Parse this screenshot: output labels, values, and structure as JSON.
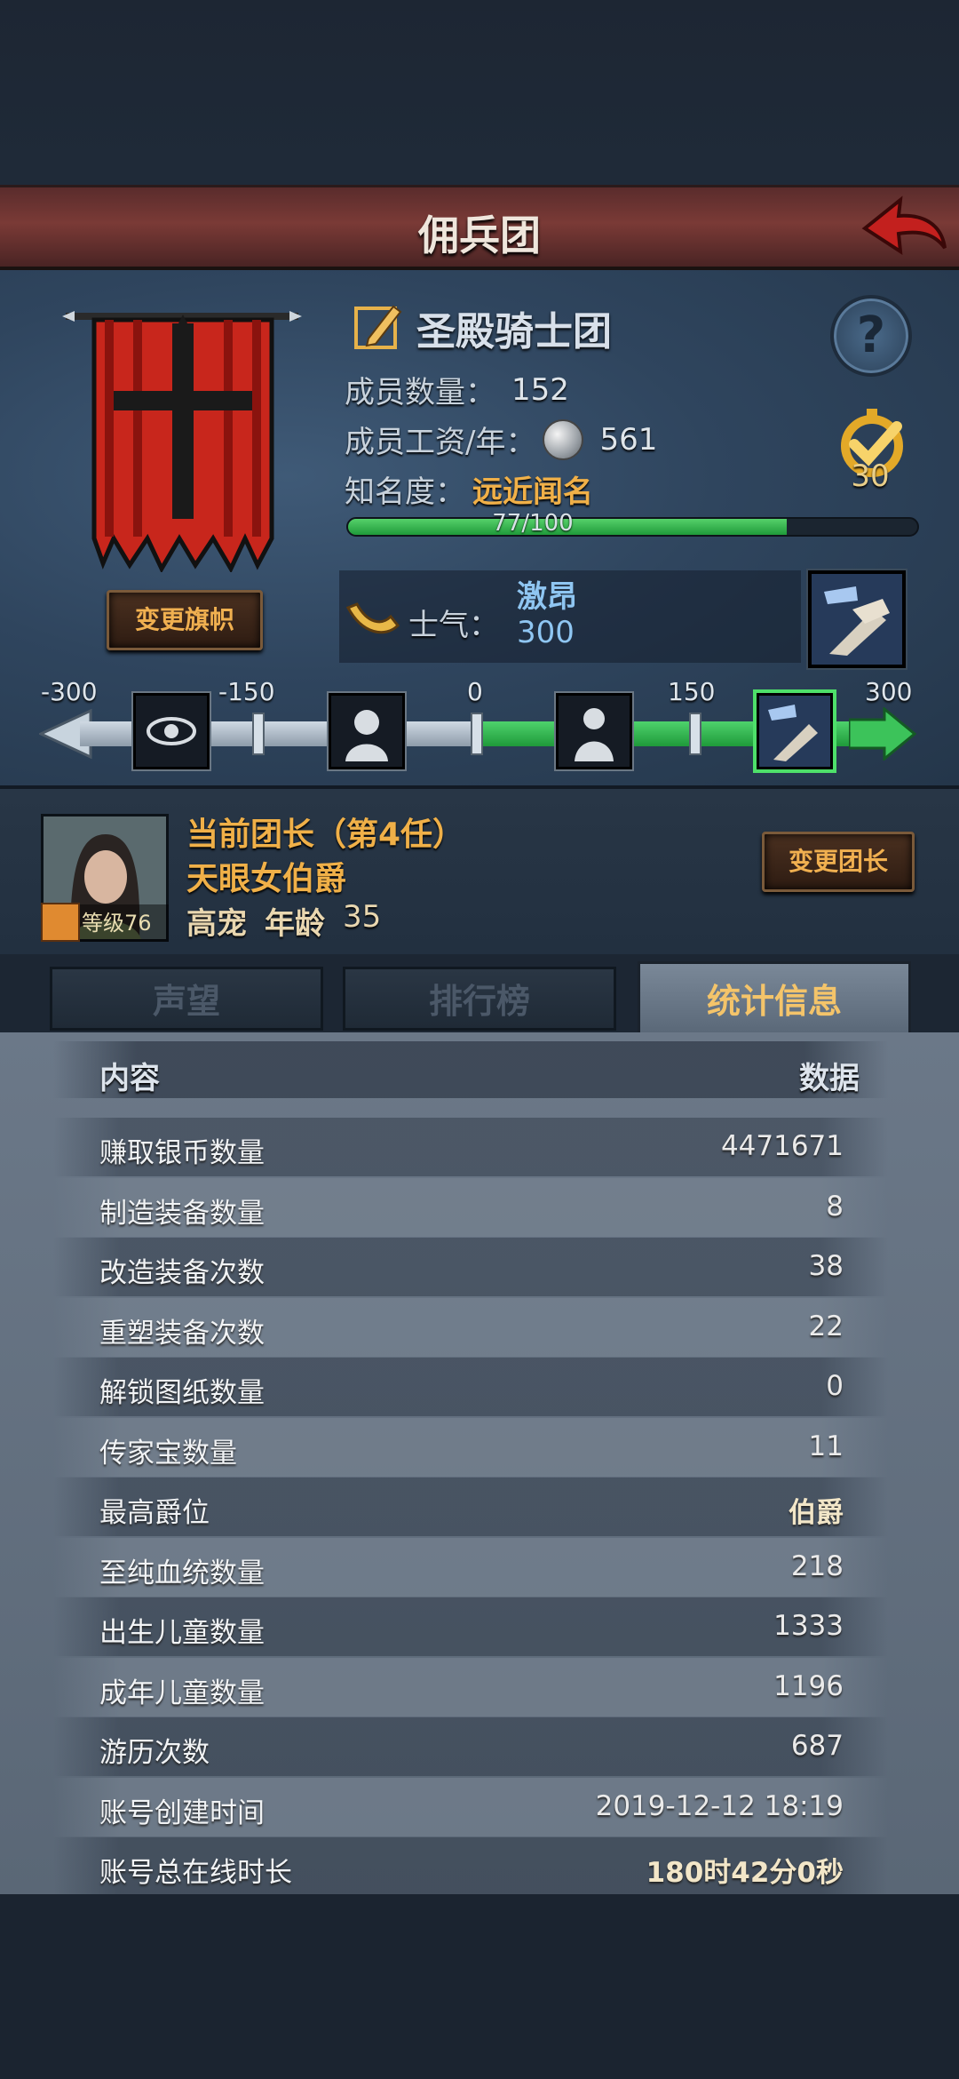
{
  "header": {
    "title": "佣兵团"
  },
  "guild": {
    "name": "圣殿骑士团",
    "members_label": "成员数量：",
    "members_value": "152",
    "wage_label": "成员工资/年：",
    "wage_value": "561",
    "fame_label": "知名度：",
    "fame_value": "远近闻名",
    "fame_progress_text": "77/100",
    "fame_progress": 0.77,
    "medal_count": "30",
    "change_flag_label": "变更旗帜",
    "help_label": "?"
  },
  "morale": {
    "label": "士气：",
    "state": "激昂",
    "value": "300",
    "ticks": [
      "-300",
      "-150",
      "0",
      "150",
      "300"
    ]
  },
  "leader": {
    "title": "当前团长（第4任）",
    "name": "天眼女伯爵",
    "level_text": "等级76",
    "race": "高宠",
    "age_label": "年龄",
    "age_value": "35",
    "change_label": "变更团长"
  },
  "tabs": [
    "声望",
    "排行榜",
    "统计信息"
  ],
  "table": {
    "col_content": "内容",
    "col_data": "数据",
    "rows": [
      {
        "key": "赚取银币数量",
        "value": "4471671"
      },
      {
        "key": "制造装备数量",
        "value": "8"
      },
      {
        "key": "改造装备次数",
        "value": "38"
      },
      {
        "key": "重塑装备次数",
        "value": "22"
      },
      {
        "key": "解锁图纸数量",
        "value": "0"
      },
      {
        "key": "传家宝数量",
        "value": "11"
      },
      {
        "key": "最高爵位",
        "value": "伯爵"
      },
      {
        "key": "至纯血统数量",
        "value": "218"
      },
      {
        "key": "出生儿童数量",
        "value": "1333"
      },
      {
        "key": "成年儿童数量",
        "value": "1196"
      },
      {
        "key": "游历次数",
        "value": "687"
      },
      {
        "key": "账号创建时间",
        "value": "2019-12-12 18:19"
      },
      {
        "key": "账号总在线时长",
        "value": "180时42分0秒"
      }
    ]
  },
  "colors": {
    "accent": "#f0b048",
    "morale": "#8fc6f2",
    "progress": "#2fb04a"
  }
}
